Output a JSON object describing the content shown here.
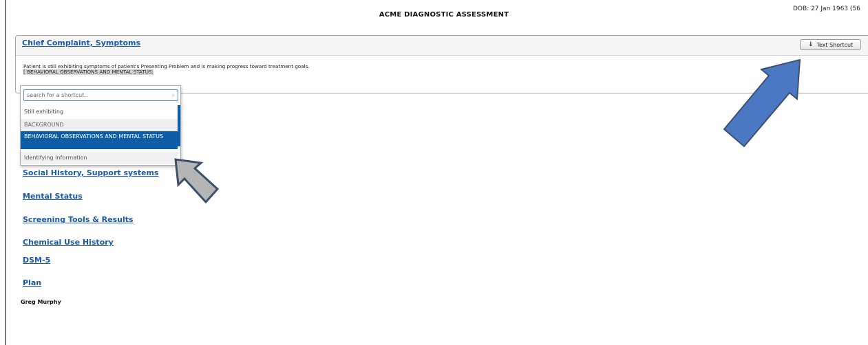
{
  "header": {
    "title": "ACME DIAGNOSTIC ASSESSMENT",
    "dob": "DOB: 27 Jan 1963 (56"
  },
  "panel": {
    "title": "Chief Complaint, Symptoms",
    "text_shortcut_label": "Text Shortcut",
    "note_line1": "Patient is still exhibiting symptoms of patient's Presenting Problem and is making progress toward treatment goals.",
    "note_line2": "[ BEHAVIORAL OBSERVATIONS AND MENTAL STATUS:"
  },
  "shortcut_dropdown": {
    "search_placeholder": "search for a shortcut..",
    "options": [
      "Still exhibiting",
      "BACKGROUND",
      "BEHAVIORAL OBSERVATIONS AND MENTAL STATUS",
      "Identifying Information"
    ],
    "selected_index": 2
  },
  "sections": [
    "Social History, Support systems",
    "Mental Status",
    "Screening Tools & Results",
    "Chemical Use History",
    "DSM-5",
    "Plan"
  ],
  "signature": "Greg Murphy",
  "colors": {
    "link": "#1a5aa8",
    "selected_option": "#0d5ea6",
    "blue_arrow": "#4a78c2",
    "gray_arrow": "#b5b5b5",
    "arrow_outline": "#3d4f6a"
  },
  "annotations": [
    {
      "icon": "blue-arrow-icon",
      "points_to": "text-shortcut-button"
    },
    {
      "icon": "gray-arrow-icon",
      "points_to": "shortcut-dropdown"
    }
  ]
}
